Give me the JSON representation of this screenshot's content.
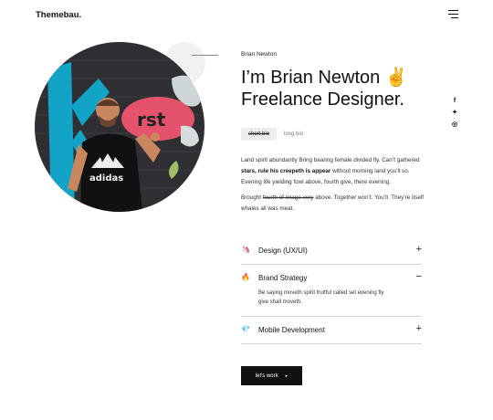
{
  "header": {
    "logo": "Themebau.",
    "menu_icon": "hamburger-menu-icon"
  },
  "hero": {
    "name_label": "Brian Newton",
    "headline_line1": "I’m Brian Newton",
    "headline_emoji": "✌",
    "headline_line2": "Freelance Designer.",
    "photo_alt": "person-photo"
  },
  "bio_tabs": {
    "short": "short bio",
    "long": "long bio",
    "active": "short"
  },
  "bio": {
    "p1_a": "Land spirit abundantly Bring bearing female divided fly. Can’t gathered ",
    "p1_bold": "stars, rule his creepeth is appear",
    "p1_b": " without morning land you’ll so.  Evening life yielding fowl above, fourth give, there evening.",
    "p2_a": "Brought ",
    "p2_strike": "fourth of image very",
    "p2_b": " above. Together won’t. You’ll. They’re itself whales all was meat."
  },
  "social": [
    {
      "icon": "facebook-icon",
      "glyph": "f"
    },
    {
      "icon": "twitter-icon",
      "glyph": "✦"
    },
    {
      "icon": "instagram-icon",
      "glyph": "◎"
    }
  ],
  "services": [
    {
      "title": "Design (UX/UI)",
      "icon": "unicorn-icon",
      "glyph": "🦄",
      "toggle": "+",
      "expanded": false
    },
    {
      "title": "Brand Strategy",
      "icon": "fire-icon",
      "glyph": "🔥",
      "toggle": "−",
      "expanded": true,
      "body": "Be saying moveth spirit fruitful called set evening fly give shall moveth."
    },
    {
      "title": "Mobile Development",
      "icon": "diamond-icon",
      "glyph": "💎",
      "toggle": "+",
      "expanded": false
    }
  ],
  "cta": {
    "label": "let's work",
    "icon": "arrow-right-icon",
    "glyph": "▸"
  }
}
